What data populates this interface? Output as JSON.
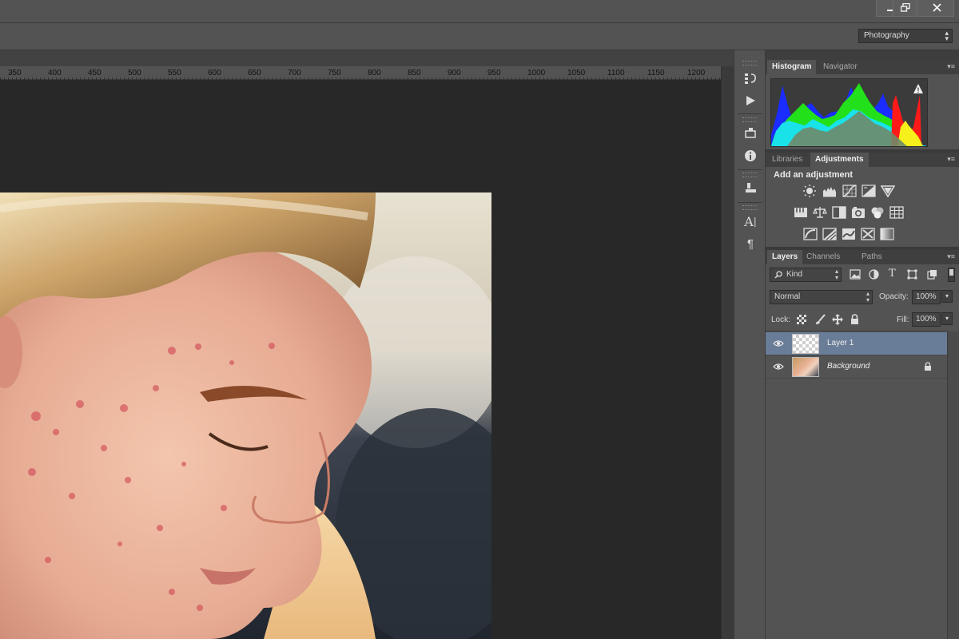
{
  "workspace": {
    "selected": "Photography"
  },
  "ruler": {
    "labels": [
      "350",
      "400",
      "450",
      "500",
      "550",
      "600",
      "650",
      "700",
      "750",
      "800",
      "850",
      "900",
      "950",
      "1000",
      "1050",
      "1100",
      "1150",
      "1200"
    ]
  },
  "histogram_panel": {
    "tabs": [
      "Histogram",
      "Navigator"
    ],
    "active_tab": "Histogram",
    "warning": "!"
  },
  "adjustments_panel": {
    "tabs": [
      "Libraries",
      "Adjustments"
    ],
    "active_tab": "Adjustments",
    "title": "Add an adjustment",
    "icons": [
      [
        "brightness-contrast-icon",
        "levels-icon",
        "curves-icon",
        "exposure-icon",
        "vibrance-icon"
      ],
      [
        "hue-saturation-icon",
        "color-balance-icon",
        "black-white-icon",
        "photo-filter-icon",
        "channel-mixer-icon",
        "color-lookup-icon"
      ],
      [
        "invert-icon",
        "posterize-icon",
        "threshold-icon",
        "selective-color-icon",
        "gradient-map-icon"
      ]
    ]
  },
  "layers_panel": {
    "tabs": [
      "Layers",
      "Channels",
      "Paths"
    ],
    "active_tab": "Layers",
    "filter_kind": "Kind",
    "blend_mode": "Normal",
    "opacity_label": "Opacity:",
    "opacity_value": "100%",
    "lock_label": "Lock:",
    "fill_label": "Fill:",
    "fill_value": "100%",
    "layers": [
      {
        "name": "Layer 1",
        "selected": true,
        "visible": true,
        "locked": false
      },
      {
        "name": "Background",
        "selected": false,
        "visible": true,
        "locked": true
      }
    ]
  },
  "colors": {
    "panel_bg": "#535353",
    "canvas_bg": "#282828",
    "selected_layer": "#6a7d98",
    "accent_histogram_blue": "#1a2cff",
    "accent_histogram_green": "#22e01a",
    "accent_histogram_red": "#ff1a1a"
  }
}
